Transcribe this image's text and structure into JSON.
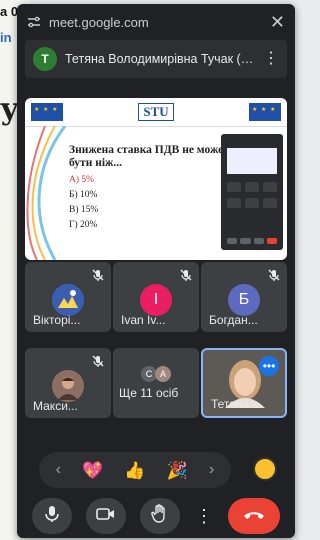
{
  "background": {
    "line1": "а 0",
    "line2": "in",
    "line3": "у"
  },
  "browser": {
    "url": "meet.google.com"
  },
  "meeting": {
    "owner_initial": "T",
    "owner_name": "Тетяна Володимирівна Тучак (Ви ...",
    "presentation": {
      "logo": "STU",
      "question": "Знижена ставка ПДВ не може бути ніж...",
      "answers": [
        "А) 5%",
        "Б) 10%",
        "В) 15%",
        "Г) 20%"
      ]
    },
    "tiles": [
      {
        "name": "Вікторі...",
        "muted": true,
        "initial": "",
        "color": "#3b5fb0"
      },
      {
        "name": "Ivan Iv...",
        "muted": true,
        "initial": "I",
        "color": "#e91e63"
      },
      {
        "name": "Богдан...",
        "muted": true,
        "initial": "Б",
        "color": "#5c6bc0"
      },
      {
        "name": "Макси...",
        "muted": true,
        "initial": "",
        "color": "#6d4c41"
      },
      {
        "name": "Ще 11 осіб",
        "muted": false,
        "initials": [
          "C",
          "A"
        ]
      },
      {
        "name": "Тетяна ...",
        "muted": false,
        "active": true
      }
    ],
    "reactions": [
      "💖",
      "👍",
      "🎉"
    ]
  },
  "colors": {
    "window_bg": "#202124",
    "tile_bg": "#3c4043",
    "end_call": "#ea4335",
    "active_border": "#8ab4f8"
  },
  "icons": {
    "controls": [
      "mic-icon",
      "camera-icon",
      "raise-hand-icon",
      "more-vert-icon",
      "end-call-icon"
    ]
  }
}
